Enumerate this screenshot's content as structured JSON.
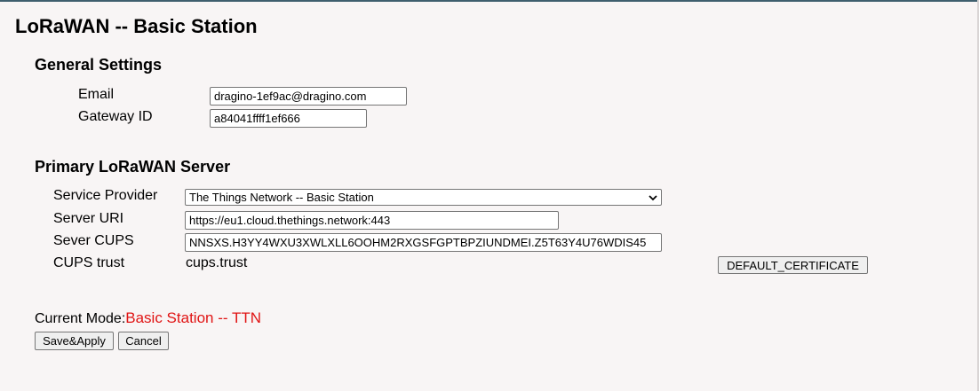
{
  "page": {
    "title": "LoRaWAN -- Basic Station"
  },
  "general": {
    "heading": "General Settings",
    "email_label": "Email",
    "email_value": "dragino-1ef9ac@dragino.com",
    "gateway_id_label": "Gateway ID",
    "gateway_id_value": "a84041ffff1ef666"
  },
  "primary": {
    "heading": "Primary LoRaWAN Server",
    "service_provider_label": "Service Provider",
    "service_provider_value": "The Things Network -- Basic Station",
    "server_uri_label": "Server URI",
    "server_uri_value": "https://eu1.cloud.thethings.network:443",
    "sever_cups_label": "Sever CUPS",
    "sever_cups_value": "NNSXS.H3YY4WXU3XWLXLL6OOHM2RXGSFGPTBPZIUNDMEI.Z5T63Y4U76WDIS45",
    "cups_trust_label": "CUPS trust",
    "cups_trust_value": "cups.trust",
    "default_cert_button": "DEFAULT_CERTIFICATE"
  },
  "mode": {
    "label": "Current Mode:",
    "value": "Basic Station -- TTN",
    "value_color": "#e01414"
  },
  "actions": {
    "save_label": "Save&Apply",
    "cancel_label": "Cancel"
  }
}
